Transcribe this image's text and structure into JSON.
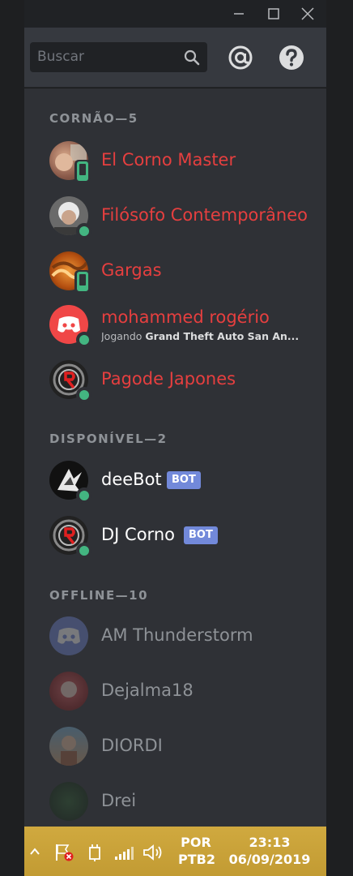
{
  "titlebar": {
    "minimize_icon": "minimize-icon",
    "maximize_icon": "maximize-icon",
    "close_icon": "close-icon"
  },
  "header": {
    "search_placeholder": "Buscar",
    "mentions_icon": "at-icon",
    "help_icon": "help-icon"
  },
  "groups": [
    {
      "title": "CORNÃO—5",
      "members": [
        {
          "name": "El Corno Master",
          "color": "#e63f3f",
          "status": "mobile"
        },
        {
          "name": "Filósofo Contemporâneo",
          "color": "#e63f3f",
          "status": "online"
        },
        {
          "name": "Gargas",
          "color": "#e63f3f",
          "status": "mobile"
        },
        {
          "name": "mohammed rogério",
          "color": "#e63f3f",
          "status": "online",
          "activity_prefix": "Jogando",
          "activity_game": "Grand Theft Auto San An..."
        },
        {
          "name": "Pagode Japones",
          "color": "#e63f3f",
          "status": "online"
        }
      ]
    },
    {
      "title": "DISPONÍVEL—2",
      "members": [
        {
          "name": "deeBot",
          "tag": "BOT",
          "status": "online"
        },
        {
          "name": "DJ Corno",
          "tag": "BOT",
          "status": "online"
        }
      ]
    },
    {
      "title": "OFFLINE—10",
      "members": [
        {
          "name": "AM Thunderstorm"
        },
        {
          "name": "Dejalma18"
        },
        {
          "name": "DIORDI"
        },
        {
          "name": "Drei"
        }
      ]
    }
  ],
  "taskbar": {
    "lang_line1": "POR",
    "lang_line2": "PTB2",
    "time": "23:13",
    "date": "06/09/2019"
  },
  "colors": {
    "role_red": "#e63f3f",
    "online": "#43b581",
    "bot_tag": "#7289da",
    "taskbar": "#c8a23a"
  }
}
